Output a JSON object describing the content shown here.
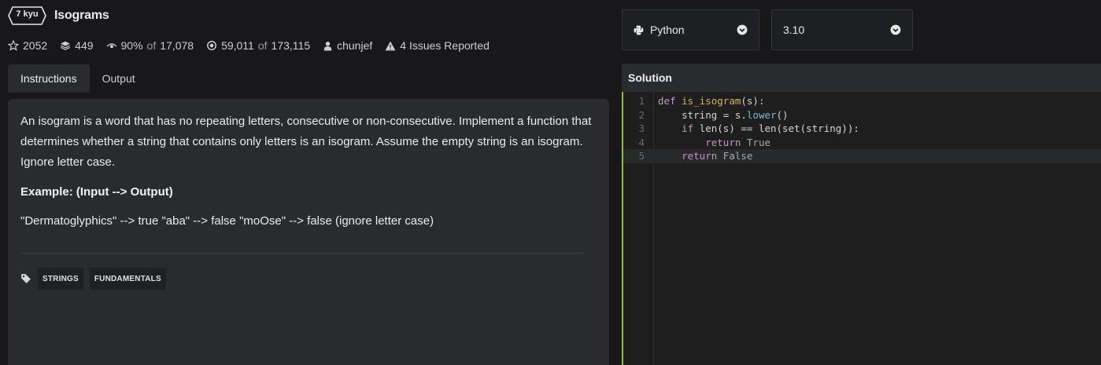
{
  "kata": {
    "rank": "7 kyu",
    "title": "Isograms"
  },
  "stats": {
    "stars": "2052",
    "collections": "449",
    "satisfaction_pct": "90%",
    "satisfaction_of": "of",
    "satisfaction_total": "17,078",
    "completed": "59,011",
    "completed_of": "of",
    "completed_total": "173,115",
    "author": "chunjef",
    "issues": "4 Issues Reported"
  },
  "tabs": [
    {
      "label": "Instructions",
      "active": true
    },
    {
      "label": "Output",
      "active": false
    }
  ],
  "instructions": {
    "description": "An isogram is a word that has no repeating letters, consecutive or non-consecutive. Implement a function that determines whether a string that contains only letters is an isogram. Assume the empty string is an isogram. Ignore letter case.",
    "example_title": "Example: (Input --> Output)",
    "example_text": "\"Dermatoglyphics\" --> true \"aba\" --> false \"moOse\" --> false (ignore letter case)",
    "tags": [
      "STRINGS",
      "FUNDAMENTALS"
    ]
  },
  "language_select": {
    "value": "Python",
    "icon": "python-icon"
  },
  "version_select": {
    "value": "3.10"
  },
  "solution": {
    "title": "Solution",
    "line_numbers": [
      "1",
      "2",
      "3",
      "4",
      "5"
    ],
    "active_line": 5,
    "code_lines": [
      "def is_isogram(s):",
      "    string = s.lower()",
      "    if len(s) == len(set(string)):",
      "        return True",
      "    return False"
    ]
  },
  "colors": {
    "background": "#18181b",
    "panel": "#2a2b2f",
    "editor_accent": "#8fbf3f"
  }
}
